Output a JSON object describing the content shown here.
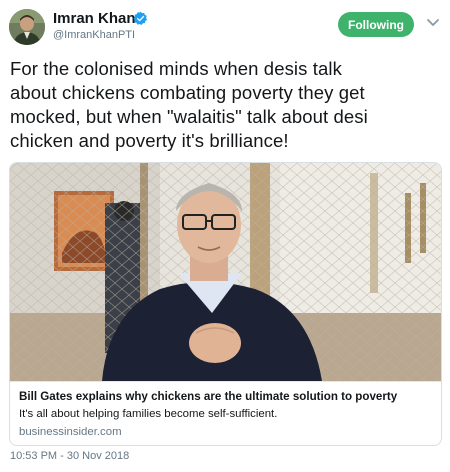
{
  "author": {
    "name": "Imran Khan",
    "handle": "@ImranKhanPTI",
    "verified": true,
    "avatar_icon": "profile-photo"
  },
  "follow_button": {
    "label": "Following",
    "color": "#3fb26b"
  },
  "menu_icon": "chevron-down-icon",
  "tweet": {
    "text": "For the colonised minds when desis talk\nabout chickens combating poverty they get\nmocked, but when \"walaitis\" talk about desi\nchicken and poverty it's brilliance!"
  },
  "card": {
    "title": "Bill Gates explains why chickens are the ultimate solution to poverty",
    "description": "It's all about helping families become self-sufficient.",
    "domain": "businessinsider.com"
  },
  "timestamp": "10:53 PM - 30 Nov 2018",
  "colors": {
    "accent": "#3fb26b",
    "verified": "#1da1f2",
    "secondary_text": "#657786"
  }
}
